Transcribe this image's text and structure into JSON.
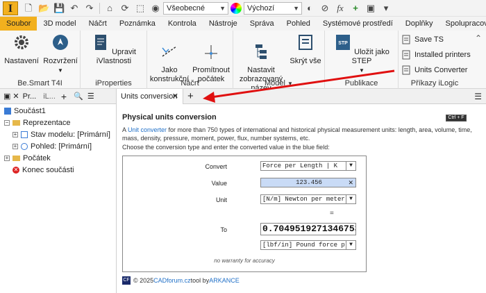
{
  "qat": {
    "appearance": "Všeobecné",
    "visual_style": "Výchozí"
  },
  "tabs": [
    "Soubor",
    "3D model",
    "Náčrt",
    "Poznámka",
    "Kontrola",
    "Nástroje",
    "Správa",
    "Pohled",
    "Systémové prostředí",
    "Doplňky",
    "Spolupracovat"
  ],
  "ribbon": {
    "groups": [
      {
        "title": "Be.Smart T4I",
        "buttons": [
          "Nastavení",
          "Rozvržení"
        ]
      },
      {
        "title": "iProperties",
        "buttons": [
          "Upravit iVlastnosti"
        ]
      },
      {
        "title": "Náčrt",
        "buttons": [
          "Jako\nkonstrukční",
          "Promítnout\npočátek"
        ]
      },
      {
        "title": "Model",
        "buttons": [
          "Nastavit\nzobrazovaný název",
          "Skrýt vše"
        ]
      },
      {
        "title": "Publikace",
        "buttons": [
          "Uložit jako STEP"
        ]
      },
      {
        "title": "Příkazy iLogic",
        "items": [
          "Save TS",
          "Installed printers",
          "Units Converter"
        ]
      }
    ]
  },
  "browser": {
    "tab1": "Pr...",
    "tab2": "iL...",
    "items": [
      {
        "label": "Součást1"
      },
      {
        "label": "Reprezentace"
      },
      {
        "label": "Stav modelu: [Primární]"
      },
      {
        "label": "Pohled: [Primární]"
      },
      {
        "label": "Počátek"
      },
      {
        "label": "Konec součásti"
      }
    ]
  },
  "doc_tab": "Units conversion",
  "converter": {
    "title": "Physical units conversion",
    "hotkey": "Ctrl + F",
    "desc_prefix": "A ",
    "desc_link": "Unit converter",
    "desc_rest": " for more than 750 types of international and historical physical measurement units: length, area, volume, time, mass, density, pressure, moment, power, flux, number systems, etc.",
    "instruction": "Choose the conversion type and enter the converted value in the blue field:",
    "convert_label": "Convert",
    "convert_value": "Force per Length | K",
    "value_label": "Value",
    "value_value": "123.456",
    "unit_label": "Unit",
    "unit_value": "[N/m] Newton per meter",
    "equals": "=",
    "to_label": "To",
    "result": "0.7049519271346753",
    "to_unit_value": "[lbf/in] Pound force p",
    "warranty": "no warranty for accuracy",
    "footer_prefix": "© 2025 ",
    "footer_link1": "CADforum.cz",
    "footer_mid": " tool by ",
    "footer_link2": "ARKANCE"
  }
}
